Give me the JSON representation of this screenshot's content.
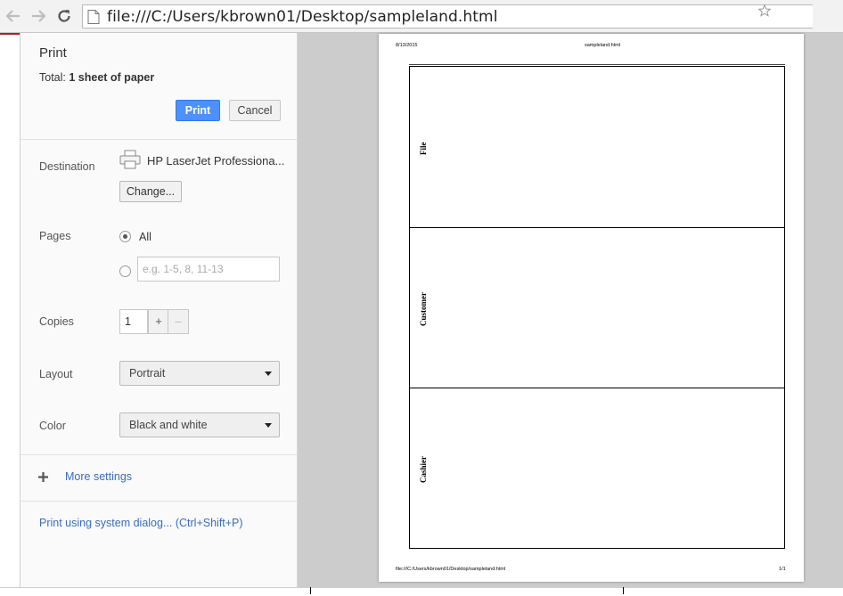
{
  "browser": {
    "url": "file:///C:/Users/kbrown01/Desktop/sampleland.html"
  },
  "print_panel": {
    "title": "Print",
    "total_label": "Total: ",
    "total_value": "1 sheet of paper",
    "print_button": "Print",
    "cancel_button": "Cancel",
    "destination": {
      "label": "Destination",
      "printer_name": "HP LaserJet Professiona...",
      "change_button": "Change..."
    },
    "pages": {
      "label": "Pages",
      "all_option": "All",
      "custom_placeholder": "e.g. 1-5, 8, 11-13"
    },
    "copies": {
      "label": "Copies",
      "value": "1",
      "plus": "+",
      "minus": "–"
    },
    "layout": {
      "label": "Layout",
      "selected": "Portrait"
    },
    "color": {
      "label": "Color",
      "selected": "Black and white"
    },
    "more_settings": "More settings",
    "system_dialog_link": "Print using system dialog... (Ctrl+Shift+P)"
  },
  "preview": {
    "header_date": "8/13/2015",
    "header_title": "sampleland.html",
    "footer_url": "file:///C:/Users/kbrown01/Desktop/sampleland.html",
    "footer_page": "1/1",
    "lanes": [
      "File",
      "Customer",
      "Cashier"
    ]
  },
  "colors": {
    "print_button": "#4d90fe",
    "link": "#3b6dbb",
    "preview_background": "#cccccc"
  }
}
